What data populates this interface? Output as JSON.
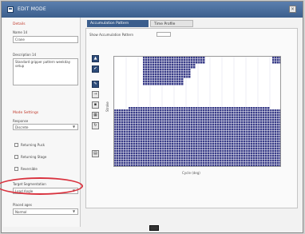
{
  "window": {
    "title": "EDIT MODE",
    "close_glyph": "×"
  },
  "left_panel": {
    "section_heading": "Details",
    "name_label": "Name 14",
    "name_value": "Crane",
    "description_label": "Description 14",
    "description_value": "Standard gripper pattern weekday setup",
    "mode_heading": "Mode Settings",
    "response_label": "Response",
    "response_value": "Discrete",
    "checkboxes": [
      {
        "label": "Returning Puck",
        "checked": false
      },
      {
        "label": "Returning Stage",
        "checked": false
      },
      {
        "label": "Reversible",
        "checked": false
      }
    ],
    "target_label": "Target Segmentation",
    "target_value": "Lead Angle",
    "placement_label": "Placed ages",
    "placement_value": "Normal"
  },
  "tabs": [
    {
      "label": "Accumulation Pattern",
      "active": true
    },
    {
      "label": "Time  Profile",
      "active": false
    }
  ],
  "pattern_control": {
    "label": "Show Accumulation Pattern"
  },
  "toolbar": [
    {
      "icon": "up-arrow-icon",
      "glyph": "▲",
      "dark": true
    },
    {
      "icon": "check-icon",
      "glyph": "✔",
      "dark": true
    },
    {
      "icon": "pencil-icon",
      "glyph": "✎",
      "dark": true
    },
    {
      "icon": "arrow-right-icon",
      "glyph": "→",
      "dark": false
    },
    {
      "icon": "eraser-icon",
      "glyph": "▪",
      "dark": false
    },
    {
      "icon": "grid-icon",
      "glyph": "▦",
      "dark": false
    },
    {
      "icon": "rotate-icon",
      "glyph": "↻",
      "dark": false
    },
    {
      "icon": "layers-icon",
      "glyph": "▤",
      "dark": false
    }
  ],
  "chart": {
    "y_axis_label": "Stroke",
    "x_axis_label": "Cycle (deg)",
    "cell_fill": "#3a3d88",
    "cell_empty": "#ffffff",
    "gridline": "#d0d0e8"
  },
  "colors": {
    "accent": "#3b5e8d",
    "annotation": "#d9333f",
    "heading": "#c0392b"
  }
}
